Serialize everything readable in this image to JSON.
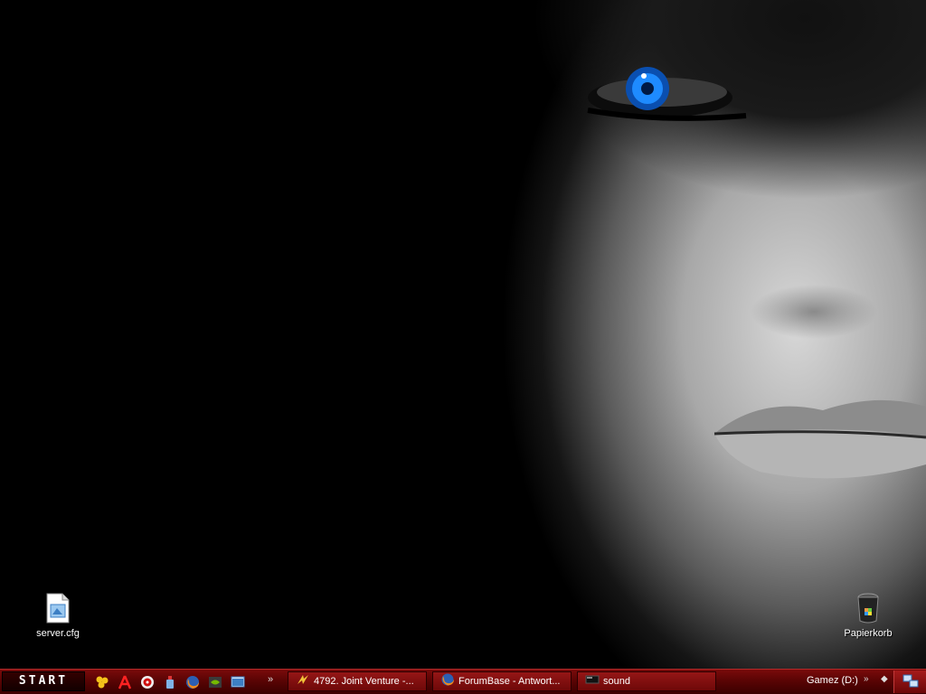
{
  "desktop": {
    "icons": [
      {
        "label": "server.cfg",
        "icon": "config-file-icon"
      },
      {
        "label": "Papierkorb",
        "icon": "recycle-bin-icon"
      }
    ]
  },
  "taskbar": {
    "start_label": "START",
    "quick_launch": [
      "tray-app-icon",
      "pdf-reader-icon",
      "media-player-icon",
      "cleaner-icon",
      "firefox-icon",
      "nvidia-icon",
      "show-desktop-icon"
    ],
    "quick_launch_more": "»",
    "tasks": [
      {
        "label": "4792. Joint Venture -...",
        "icon": "app-icon"
      },
      {
        "label": "ForumBase - Antwort...",
        "icon": "firefox-icon"
      },
      {
        "label": "sound",
        "icon": "window-icon"
      }
    ],
    "toolbar_drive": "Gamez (D:)",
    "toolbar_more": "»",
    "toolbar_show": "◆"
  },
  "colors": {
    "taskbar": "#6e0909",
    "eye": "#1e8bff"
  }
}
